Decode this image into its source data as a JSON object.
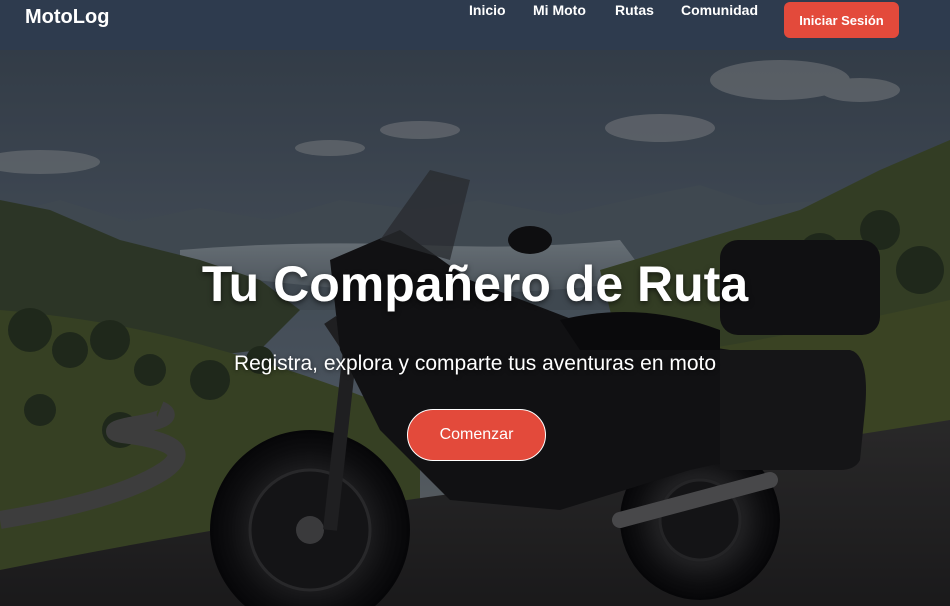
{
  "header": {
    "brand": "MotoLog",
    "nav": [
      {
        "label": "Inicio"
      },
      {
        "label": "Mi Moto"
      },
      {
        "label": "Rutas"
      },
      {
        "label": "Comunidad"
      }
    ],
    "login_label": "Iniciar Sesión"
  },
  "hero": {
    "title": "Tu Compañero de Ruta",
    "subtitle": "Registra, explora y comparte tus aventuras en moto",
    "cta_label": "Comenzar"
  },
  "colors": {
    "header_bg": "#2e3b4e",
    "accent": "#e34a3b",
    "text": "#ffffff"
  }
}
